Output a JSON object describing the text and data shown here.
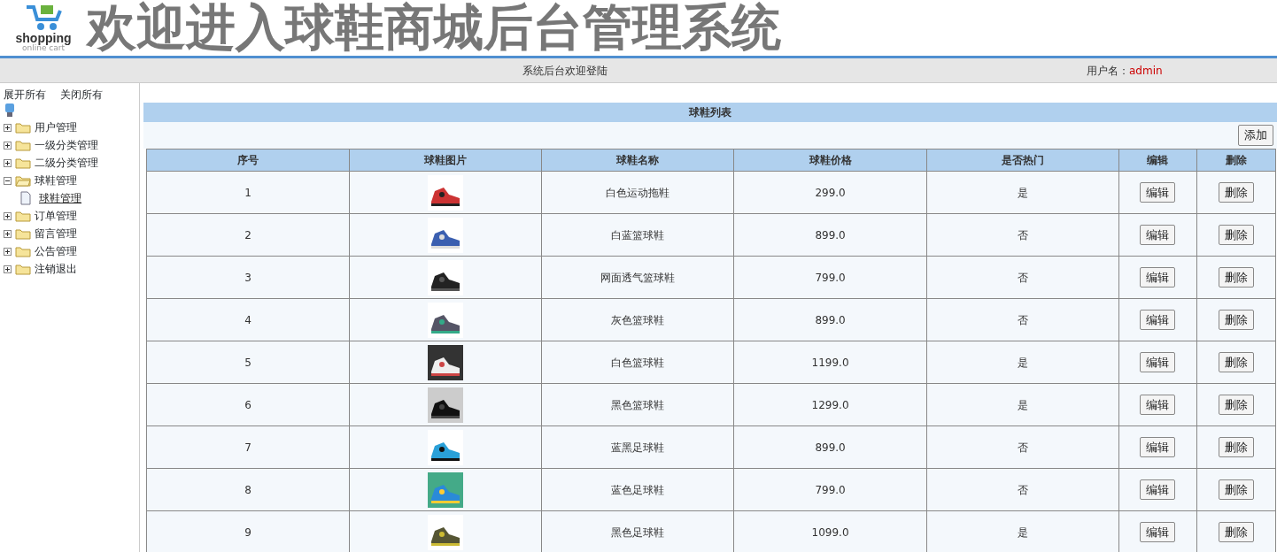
{
  "header": {
    "logo_text": "shopping",
    "logo_subtext": "online cart",
    "title": "欢迎进入球鞋商城后台管理系统"
  },
  "top_bar": {
    "welcome": "系统后台欢迎登陆",
    "user_label": "用户名：",
    "user_name": "admin"
  },
  "sidebar": {
    "expand_all": "展开所有",
    "collapse_all": "关闭所有",
    "items": [
      {
        "label": "用户管理",
        "expanded": false
      },
      {
        "label": "一级分类管理",
        "expanded": false
      },
      {
        "label": "二级分类管理",
        "expanded": false
      },
      {
        "label": "球鞋管理",
        "expanded": true,
        "children": [
          {
            "label": "球鞋管理"
          }
        ]
      },
      {
        "label": "订单管理",
        "expanded": false
      },
      {
        "label": "留言管理",
        "expanded": false
      },
      {
        "label": "公告管理",
        "expanded": false
      },
      {
        "label": "注销退出",
        "expanded": false
      }
    ]
  },
  "panel": {
    "title": "球鞋列表",
    "add_button": "添加"
  },
  "table": {
    "columns": [
      "序号",
      "球鞋图片",
      "球鞋名称",
      "球鞋价格",
      "是否热门",
      "编辑",
      "删除"
    ],
    "rows": [
      {
        "index": "1",
        "name": "白色运动拖鞋",
        "price": "299.0",
        "hot": "是",
        "edit": "编辑",
        "delete": "删除"
      },
      {
        "index": "2",
        "name": "白蓝篮球鞋",
        "price": "899.0",
        "hot": "否",
        "edit": "编辑",
        "delete": "删除"
      },
      {
        "index": "3",
        "name": "网面透气篮球鞋",
        "price": "799.0",
        "hot": "否",
        "edit": "编辑",
        "delete": "删除"
      },
      {
        "index": "4",
        "name": "灰色篮球鞋",
        "price": "899.0",
        "hot": "否",
        "edit": "编辑",
        "delete": "删除"
      },
      {
        "index": "5",
        "name": "白色篮球鞋",
        "price": "1199.0",
        "hot": "是",
        "edit": "编辑",
        "delete": "删除"
      },
      {
        "index": "6",
        "name": "黑色篮球鞋",
        "price": "1299.0",
        "hot": "是",
        "edit": "编辑",
        "delete": "删除"
      },
      {
        "index": "7",
        "name": "蓝黑足球鞋",
        "price": "899.0",
        "hot": "否",
        "edit": "编辑",
        "delete": "删除"
      },
      {
        "index": "8",
        "name": "蓝色足球鞋",
        "price": "799.0",
        "hot": "否",
        "edit": "编辑",
        "delete": "删除"
      },
      {
        "index": "9",
        "name": "黑色足球鞋",
        "price": "1099.0",
        "hot": "是",
        "edit": "编辑",
        "delete": "删除"
      }
    ]
  }
}
